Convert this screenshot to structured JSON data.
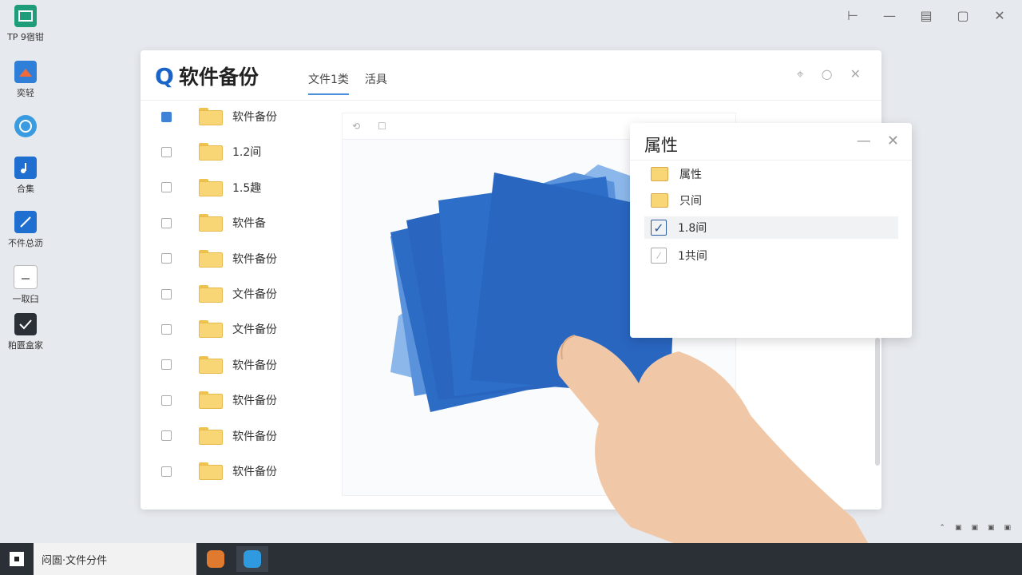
{
  "desktop": {
    "icons": [
      {
        "label": "TP 9宿钳",
        "icon": "app-window-icon"
      },
      {
        "label": "奕轻",
        "icon": "mountain-app-icon"
      },
      {
        "label": "",
        "icon": "browser-globe-icon"
      },
      {
        "label": "合集",
        "icon": "music-app-icon"
      },
      {
        "label": "不件总沥",
        "icon": "chart-app-icon"
      },
      {
        "label": "一取臼",
        "icon": "document-icon"
      },
      {
        "label": "粕匮盒家",
        "icon": "checkmark-app-icon"
      }
    ]
  },
  "system_buttons": [
    "pin-icon",
    "minimize-icon",
    "restore-icon",
    "maximize-icon",
    "close-icon"
  ],
  "window": {
    "logo": "Q",
    "title": "软件备份",
    "tabs": [
      {
        "label": "文件1类",
        "active": true
      },
      {
        "label": "活具",
        "active": false
      }
    ],
    "controls": [
      "pin-icon",
      "circle-icon",
      "close-icon"
    ],
    "files": [
      {
        "name": "软件备份",
        "checked": true
      },
      {
        "name": "1.2间",
        "checked": false
      },
      {
        "name": "1.5趣",
        "checked": false
      },
      {
        "name": "软件备",
        "checked": false
      },
      {
        "name": "软件备份",
        "checked": false
      },
      {
        "name": "文件备份",
        "checked": false
      },
      {
        "name": "文件备份",
        "checked": false
      },
      {
        "name": "软件备份",
        "checked": false
      },
      {
        "name": "软件备份",
        "checked": false
      },
      {
        "name": "软件备份",
        "checked": false
      },
      {
        "name": "软件备份",
        "checked": false
      }
    ]
  },
  "properties": {
    "title": "属性",
    "items": [
      {
        "label": "属性",
        "kind": "folder",
        "selected": false
      },
      {
        "label": "只间",
        "kind": "folder",
        "selected": false
      },
      {
        "label": "1.8间",
        "kind": "checkbox-on",
        "selected": true
      },
      {
        "label": "1共间",
        "kind": "checkbox-off",
        "selected": false
      }
    ]
  },
  "taskbar": {
    "search_text": "闷圄·文件分件",
    "apps": [
      "orange-app-icon",
      "blue-chat-app-icon"
    ]
  },
  "colors": {
    "accent": "#1a63c8",
    "folder": "#f9d675",
    "paper": "#2a66bf",
    "taskbar": "#2b2f36"
  }
}
